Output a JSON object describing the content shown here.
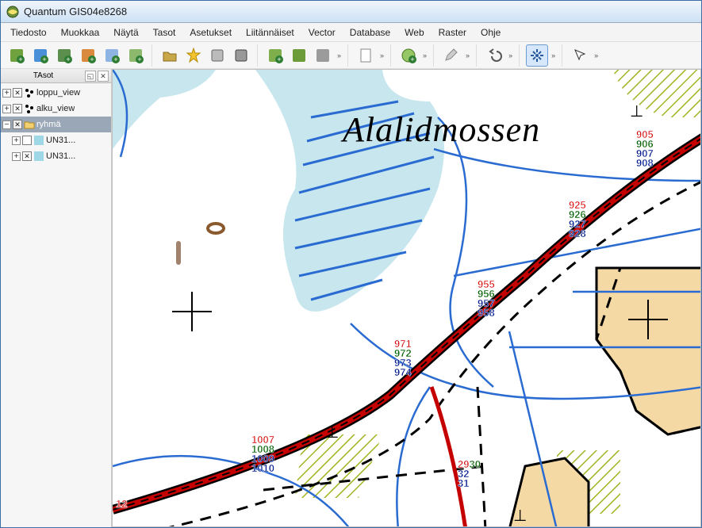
{
  "window": {
    "title": "Quantum GIS04e8268"
  },
  "menu": [
    "Tiedosto",
    "Muokkaa",
    "Näytä",
    "Tasot",
    "Asetukset",
    "Liitännäiset",
    "Vector",
    "Database",
    "Web",
    "Raster",
    "Ohje"
  ],
  "layers_panel": {
    "title": "TAsot"
  },
  "layers": [
    {
      "name": "loppu_view",
      "checked": true,
      "kind": "points",
      "expand": "plus"
    },
    {
      "name": "alku_view",
      "checked": true,
      "kind": "points",
      "expand": "plus"
    },
    {
      "name": "ryhmä",
      "checked": true,
      "kind": "group",
      "expand": "minus",
      "selected": true,
      "children": [
        {
          "name": "UN31...",
          "checked": false,
          "kind": "raster",
          "expand": "plus"
        },
        {
          "name": "UN31...",
          "checked": true,
          "kind": "raster",
          "expand": "plus"
        }
      ]
    }
  ],
  "map_labels": {
    "big": "Alalidmossen"
  },
  "points": {
    "cluster_ne": {
      "items": [
        "905",
        "906",
        "907",
        "908"
      ]
    },
    "cluster_925": {
      "items": [
        "925",
        "926",
        "927",
        "928"
      ]
    },
    "cluster_955": {
      "items": [
        "955",
        "956",
        "957",
        "958"
      ]
    },
    "cluster_971": {
      "items": [
        "971",
        "972",
        "973",
        "974"
      ]
    },
    "cluster_1007": {
      "items": [
        "1007",
        "1008",
        "1009",
        "1010"
      ]
    },
    "cluster_29": {
      "a": "29",
      "b": "30",
      "c": "32",
      "d": "31"
    },
    "cluster_bot": {
      "a": "12"
    }
  }
}
